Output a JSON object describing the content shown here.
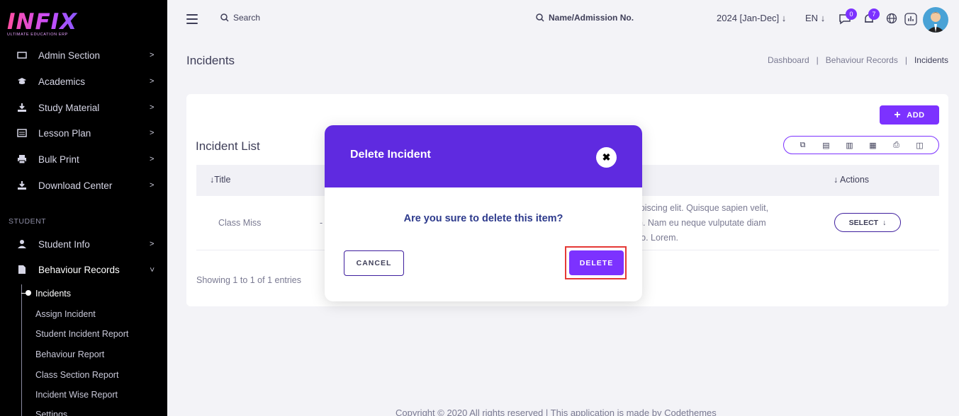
{
  "brand": {
    "logo_text": "INFIX",
    "tagline": "ULTIMATE EDUCATION ERP"
  },
  "sidebar": {
    "items": [
      {
        "label": "Admin Section",
        "icon": "admin-icon"
      },
      {
        "label": "Academics",
        "icon": "graduation-cap-icon"
      },
      {
        "label": "Study Material",
        "icon": "download-icon"
      },
      {
        "label": "Lesson Plan",
        "icon": "list-icon"
      },
      {
        "label": "Bulk Print",
        "icon": "printer-icon"
      },
      {
        "label": "Download Center",
        "icon": "download-icon"
      }
    ],
    "section_student": "STUDENT",
    "student_items": [
      {
        "label": "Student Info",
        "icon": "user-icon"
      },
      {
        "label": "Behaviour Records",
        "icon": "file-icon"
      }
    ],
    "sub_items": [
      "Incidents",
      "Assign Incident",
      "Student Incident Report",
      "Behaviour Report",
      "Class Section Report",
      "Incident Wise Report",
      "Settings"
    ]
  },
  "topbar": {
    "search_label": "Search",
    "search2_label": "Name/Admission No.",
    "year": "2024 [Jan-Dec]",
    "lang": "EN",
    "chat_count": "0",
    "notif_count": "7"
  },
  "page": {
    "title": "Incidents",
    "breadcrumb": [
      "Dashboard",
      "Behaviour Records",
      "Incidents"
    ],
    "sep": "|"
  },
  "card": {
    "add_label": "ADD",
    "list_title": "Incident List",
    "columns": {
      "title": "Title",
      "actions": "Actions"
    },
    "row": {
      "title": "Class Miss",
      "dash": "-",
      "desc_lines": [
        "ipiscing elit. Quisque sapien velit,",
        "n. Nam eu neque vulputate diam",
        "ro. Lorem."
      ],
      "select_label": "SELECT"
    },
    "showing": "Showing 1 to 1 of 1 entries"
  },
  "footer": "Copyright © 2020 All rights reserved | This application is made by Codethemes",
  "modal": {
    "title": "Delete Incident",
    "question": "Are you sure to delete this item?",
    "cancel_label": "CANCEL",
    "delete_label": "DELETE"
  },
  "colors": {
    "accent": "#7c32ff",
    "modal_header": "#5f2ae0",
    "highlight": "#e53935"
  }
}
